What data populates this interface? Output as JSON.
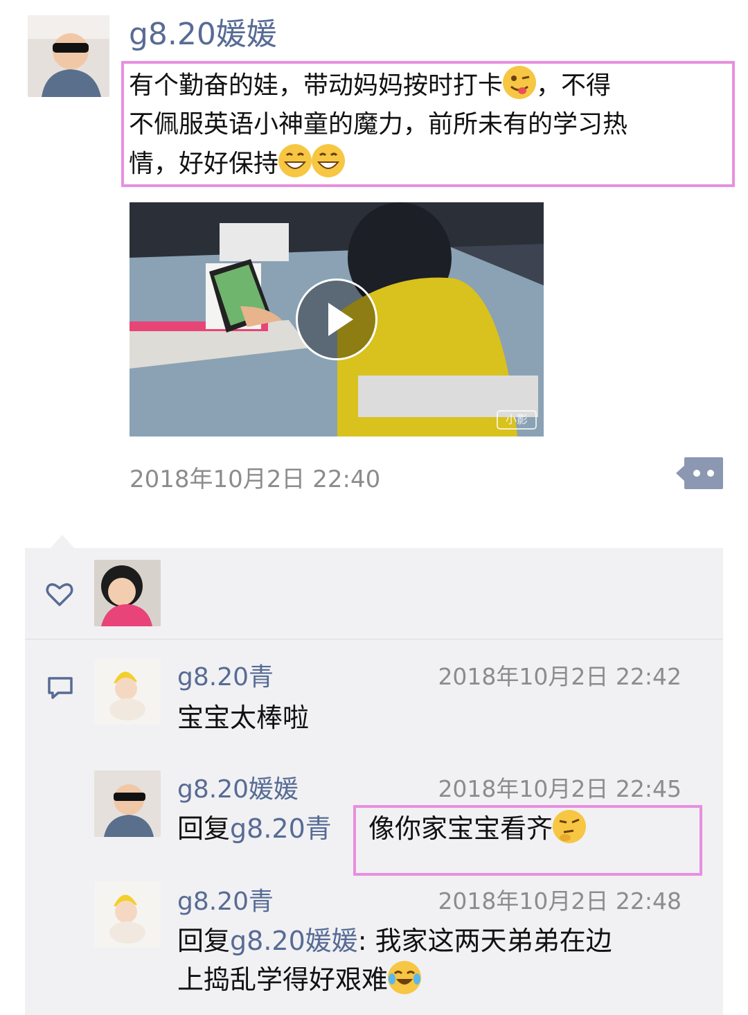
{
  "post": {
    "author": "g8.20媛媛",
    "text_line1": "有个勤奋的娃，带动妈妈按时打卡",
    "text_line1_tail": "，不得",
    "text_line2": "不佩服英语小神童的魔力，前所未有的学习热",
    "text_line3": "情，好好保持",
    "video_badge": "小影",
    "timestamp": "2018年10月2日 22:40"
  },
  "icons": {
    "more": "more-dots-icon",
    "like": "heart-icon",
    "comment": "comment-icon",
    "play": "play-icon"
  },
  "comments": [
    {
      "name": "g8.20青",
      "time": "2018年10月2日 22:42",
      "text": "宝宝太棒啦"
    },
    {
      "name": "g8.20媛媛",
      "time": "2018年10月2日 22:45",
      "reply_prefix": "回复",
      "reply_to": "g8.20青",
      "text": "像你家宝宝看齐"
    },
    {
      "name": "g8.20青",
      "time": "2018年10月2日 22:48",
      "reply_prefix": "回复",
      "reply_to": "g8.20媛媛",
      "text_line1": ": 我家这两天弟弟在边",
      "text_line2": "上捣乱学得好艰难"
    }
  ],
  "colors": {
    "name_link": "#576b95",
    "highlight_box": "#e88fe0",
    "panel_bg": "#f1f1f3",
    "more_button": "#8c97b2"
  }
}
